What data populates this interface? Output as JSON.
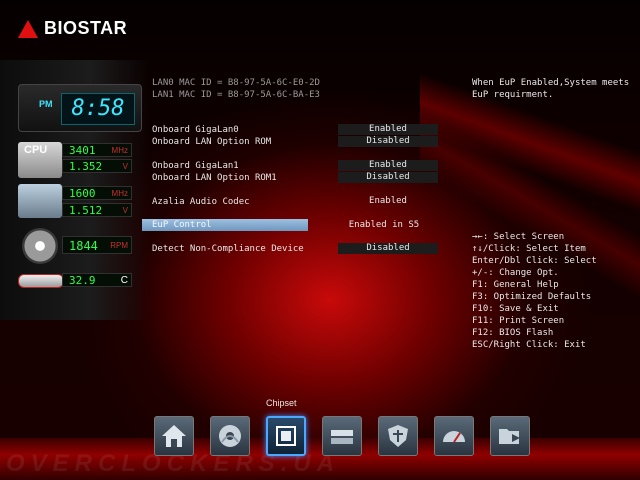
{
  "brand": {
    "logo_text": "BIOSTAR"
  },
  "monitor": {
    "clock_period": "PM",
    "clock_time": "8:58",
    "cpu_label": "CPU",
    "cpu_freq": "3401",
    "cpu_freq_unit": "MHz",
    "cpu_volt": "1.352",
    "cpu_volt_unit": "V",
    "mem_freq": "1600",
    "mem_freq_unit": "MHz",
    "mem_volt": "1.512",
    "mem_volt_unit": "V",
    "fan_rpm": "1844",
    "fan_unit": "RPM",
    "temp": "32.9",
    "temp_unit": "C"
  },
  "settings": {
    "lan0_mac": "LAN0 MAC ID = B8-97-5A-6C-E0-2D",
    "lan1_mac": "LAN1 MAC ID = B8-97-5A-6C-BA-E3",
    "items": [
      {
        "label": "Onboard GigaLan0",
        "value": "Enabled"
      },
      {
        "label": "Onboard LAN Option ROM",
        "value": "Disabled"
      },
      {
        "label": "Onboard GigaLan1",
        "value": "Enabled"
      },
      {
        "label": "Onboard LAN Option ROM1",
        "value": "Disabled"
      },
      {
        "label": "Azalia Audio Codec",
        "value": "Enabled"
      },
      {
        "label": "EuP Control",
        "value": "Enabled in S5"
      },
      {
        "label": "Detect Non-Compliance Device",
        "value": "Disabled"
      }
    ]
  },
  "help": {
    "description_line1": "When EuP Enabled,System meets",
    "description_line2": "EuP requirment.",
    "keys": [
      "→←: Select Screen",
      "↑↓/Click: Select Item",
      "Enter/Dbl Click: Select",
      "+/-: Change Opt.",
      "F1: General Help",
      "F3: Optimized Defaults",
      "F10: Save & Exit",
      "F11: Print Screen",
      "F12: BIOS Flash",
      "ESC/Right Click: Exit"
    ]
  },
  "dock": {
    "active_label": "Chipset",
    "watermark": "OVERCLOCKERS.UA",
    "icons": [
      "home-icon",
      "cd-disc-icon",
      "chipset-icon",
      "drive-icon",
      "security-shield-icon",
      "speedometer-icon",
      "exit-folder-icon"
    ]
  },
  "colors": {
    "accent": "#e01010",
    "lcd_green": "#2cff4a",
    "lcd_cyan": "#3ee6ff",
    "highlight": "#8fb3d8"
  }
}
